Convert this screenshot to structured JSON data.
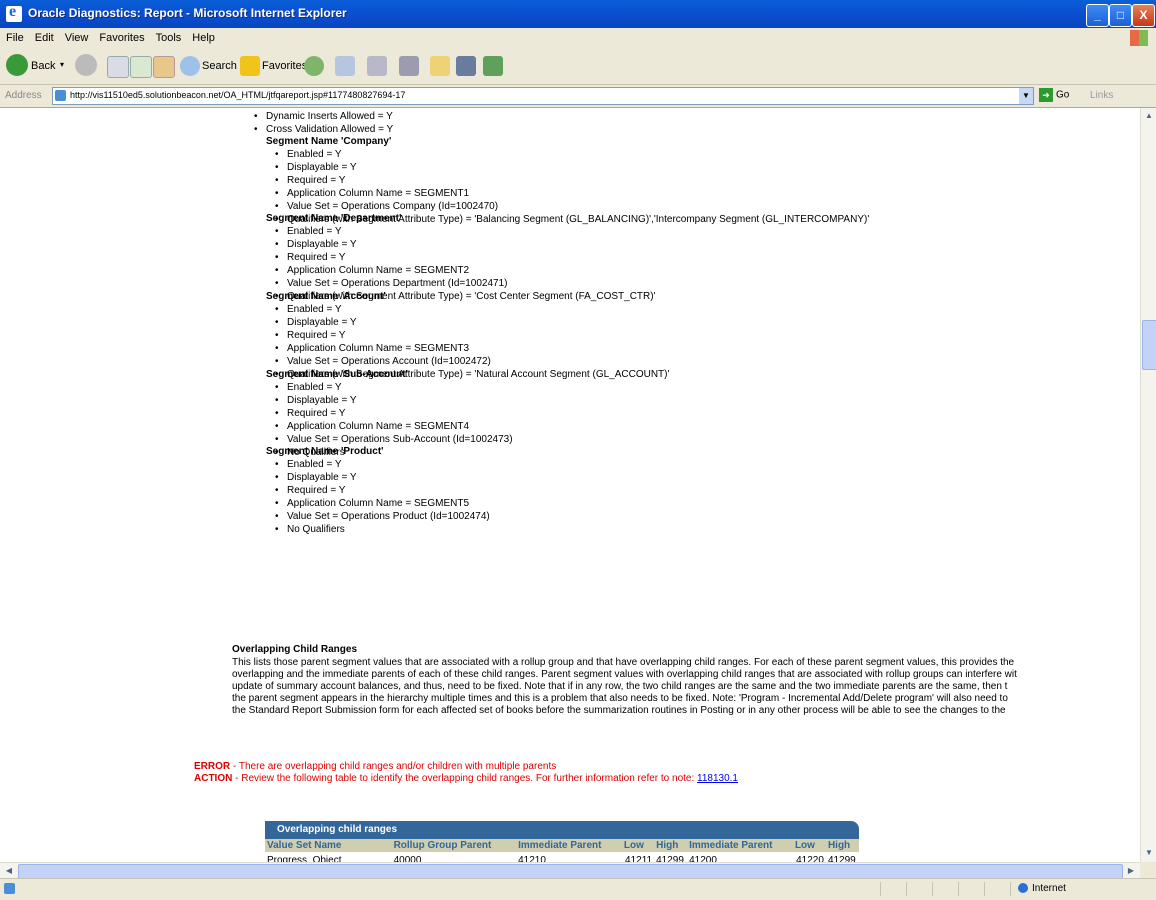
{
  "window": {
    "title": "Oracle Diagnostics: Report - Microsoft Internet Explorer",
    "minimize": "_",
    "maximize": "□",
    "close": "X"
  },
  "menubar": [
    "File",
    "Edit",
    "View",
    "Favorites",
    "Tools",
    "Help"
  ],
  "toolbar": {
    "back": "Back",
    "search": "Search",
    "favorites": "Favorites"
  },
  "address": {
    "label": "Address",
    "url": "http://vis11510ed5.solutionbeacon.net/OA_HTML/jtfqareport.jsp#1177480827694-17",
    "go": "Go",
    "links": "Links"
  },
  "status": {
    "zone": "Internet"
  },
  "report": {
    "top_items": [
      "Dynamic Inserts Allowed = Y",
      "Cross Validation Allowed = Y"
    ],
    "segments": [
      {
        "heading": "Segment Name 'Company'",
        "items": [
          "Enabled = Y",
          "Displayable = Y",
          "Required = Y",
          "Application Column Name = SEGMENT1",
          "Value Set = Operations Company (Id=1002470)",
          "Qualifiers (with Segment Attribute Type) = 'Balancing Segment (GL_BALANCING)','Intercompany Segment (GL_INTERCOMPANY)'"
        ]
      },
      {
        "heading": "Segment Name 'Department'",
        "items": [
          "Enabled = Y",
          "Displayable = Y",
          "Required = Y",
          "Application Column Name = SEGMENT2",
          "Value Set = Operations Department (Id=1002471)",
          "Qualifiers (with Segment Attribute Type) = 'Cost Center Segment (FA_COST_CTR)'"
        ]
      },
      {
        "heading": "Segment Name 'Account'",
        "items": [
          "Enabled = Y",
          "Displayable = Y",
          "Required = Y",
          "Application Column Name = SEGMENT3",
          "Value Set = Operations Account (Id=1002472)",
          "Qualifiers (with Segment Attribute Type) = 'Natural Account Segment (GL_ACCOUNT)'"
        ]
      },
      {
        "heading": "Segment Name 'Sub-Account'",
        "items": [
          "Enabled = Y",
          "Displayable = Y",
          "Required = Y",
          "Application Column Name = SEGMENT4",
          "Value Set = Operations Sub-Account (Id=1002473)",
          "No Qualifiers"
        ]
      },
      {
        "heading": "Segment Name 'Product'",
        "items": [
          "Enabled = Y",
          "Displayable = Y",
          "Required = Y",
          "Application Column Name = SEGMENT5",
          "Value Set = Operations Product (Id=1002474)",
          "No Qualifiers"
        ]
      }
    ],
    "overlap_heading": "Overlapping Child Ranges",
    "overlap_paragraph": [
      "This lists those parent segment values that are associated with a rollup group and that have overlapping child ranges. For each of these parent segment values, this provides the",
      "overlapping and the immediate parents of each of these child ranges. Parent segment values with overlapping child ranges that are associated with rollup groups can interfere wit",
      "update of summary account balances, and thus, need to be fixed. Note that if in any row, the two child ranges are the same and the two immediate parents are the same, then t",
      "the parent segment appears in the hierarchy multiple times and this is a problem that also needs to be fixed. Note: 'Program - Incremental Add/Delete program' will also need to",
      "the Standard Report Submission form for each affected set of books before the summarization routines in Posting or in any other process will be able to see the changes to the"
    ],
    "error_label": "ERROR",
    "error_text": " - There are overlapping child ranges and/or children with multiple parents",
    "action_label": "ACTION",
    "action_text": " - Review the following table to identify the overlapping child ranges. For further information refer to note: ",
    "note_link": "118130.1",
    "table": {
      "title": "Overlapping child ranges",
      "headers": [
        "Value Set Name",
        "Rollup Group Parent",
        "Immediate Parent",
        "Low",
        "High",
        "Immediate Parent",
        "Low",
        "High"
      ],
      "rows": [
        [
          "Progress_Object",
          "40000",
          "41210",
          "41211",
          "41299",
          "41200",
          "41220",
          "41299"
        ]
      ]
    }
  }
}
